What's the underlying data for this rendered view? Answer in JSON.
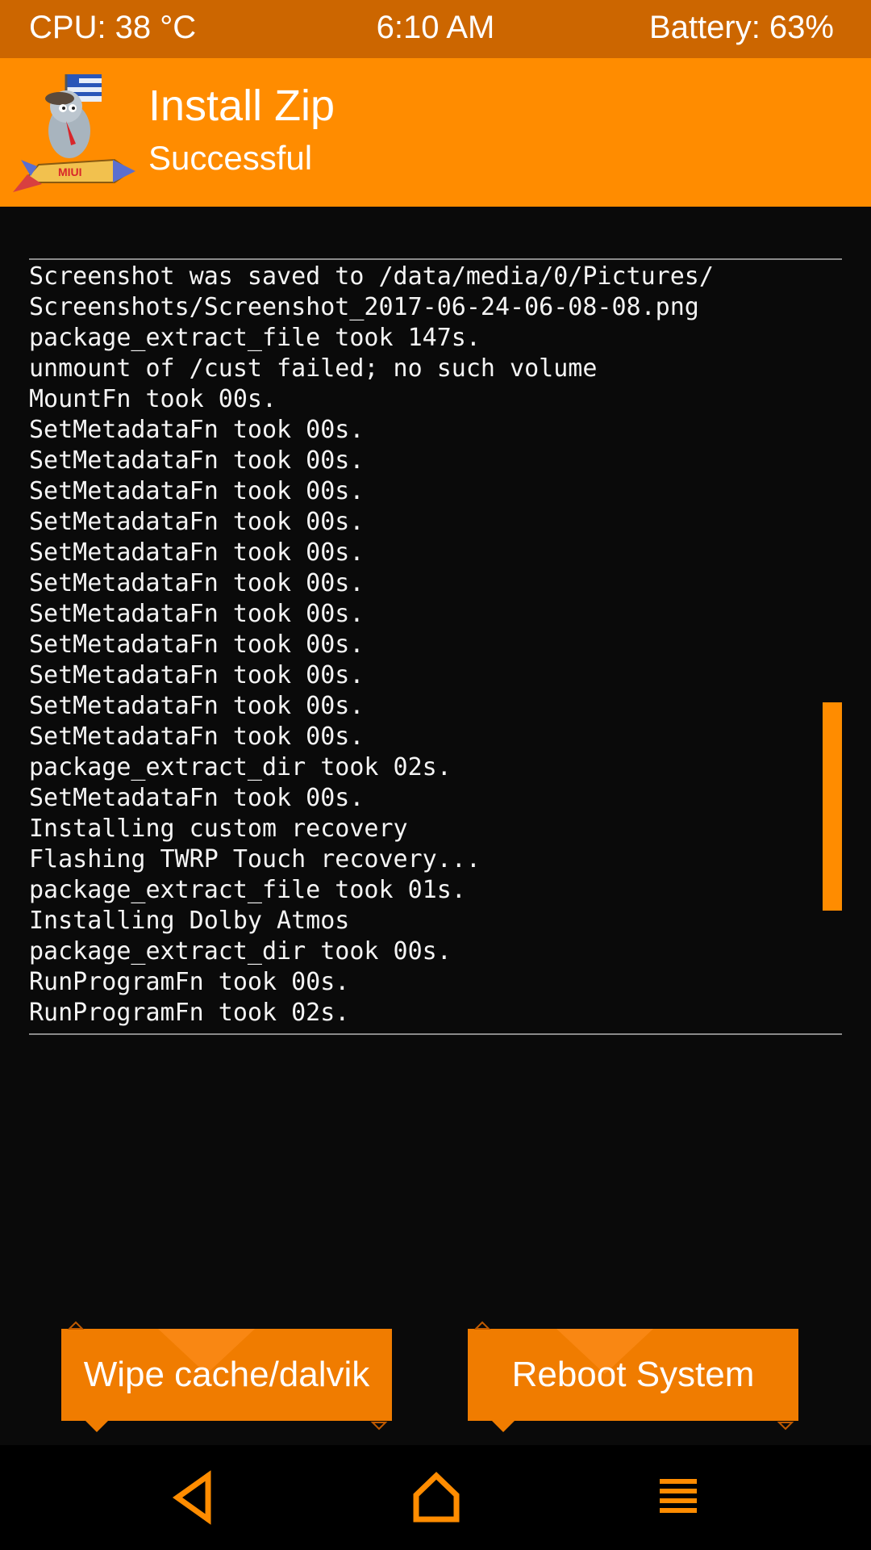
{
  "status_bar": {
    "cpu": "CPU: 38 °C",
    "time": "6:10 AM",
    "battery": "Battery: 63%"
  },
  "header": {
    "title": "Install Zip",
    "subtitle": "Successful",
    "logo_icon": "miui-rocket-mascot-logo",
    "logo_text": "MIUI"
  },
  "console": {
    "lines": [
      "Screenshot was saved to /data/media/0/Pictures/",
      "Screenshots/Screenshot_2017-06-24-06-08-08.png",
      "package_extract_file took 147s.",
      "unmount of /cust failed; no such volume",
      "MountFn took 00s.",
      "SetMetadataFn took 00s.",
      "SetMetadataFn took 00s.",
      "SetMetadataFn took 00s.",
      "SetMetadataFn took 00s.",
      "SetMetadataFn took 00s.",
      "SetMetadataFn took 00s.",
      "SetMetadataFn took 00s.",
      "SetMetadataFn took 00s.",
      "SetMetadataFn took 00s.",
      "SetMetadataFn took 00s.",
      "SetMetadataFn took 00s.",
      "package_extract_dir took 02s.",
      "SetMetadataFn took 00s.",
      "Installing custom recovery",
      "Flashing TWRP Touch recovery...",
      "package_extract_file took 01s.",
      "Installing Dolby Atmos",
      "package_extract_dir took 00s.",
      "RunProgramFn took 00s.",
      "RunProgramFn took 02s."
    ]
  },
  "actions": {
    "wipe_label": "Wipe cache/dalvik",
    "reboot_label": "Reboot System"
  },
  "nav": {
    "back_icon": "back-triangle-icon",
    "home_icon": "home-icon",
    "menu_icon": "menu-icon"
  },
  "colors": {
    "status_bar": "#cc6600",
    "accent": "#ff8c00",
    "button": "#f07c00",
    "background": "#0a0a0a"
  }
}
